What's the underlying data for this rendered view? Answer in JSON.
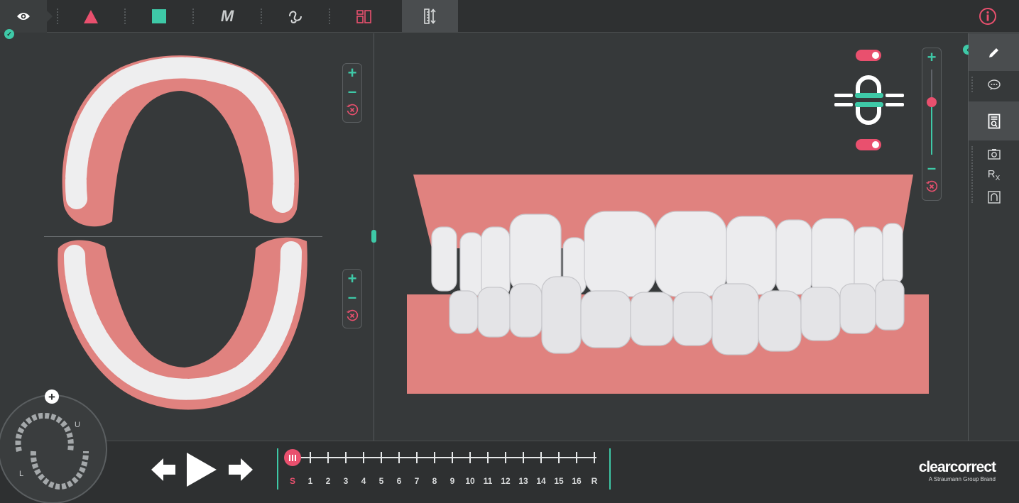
{
  "toolbar": {
    "tools": [
      {
        "name": "view",
        "icon": "eye-icon"
      },
      {
        "name": "shape",
        "icon": "triangle-icon",
        "color": "#e9506e"
      },
      {
        "name": "block",
        "icon": "square-icon",
        "color": "#3ec9a7"
      },
      {
        "name": "mode",
        "icon": "m-icon",
        "label": "M"
      },
      {
        "name": "wave",
        "icon": "wave-icon"
      },
      {
        "name": "layout",
        "icon": "split-view-icon",
        "color": "#e9506e"
      },
      {
        "name": "measure",
        "icon": "ruler-arrows-icon"
      }
    ],
    "info_icon": "info-icon",
    "info_color": "#e9506e"
  },
  "brand": {
    "name": "clearcorrect",
    "tagline": "A Straumann Group Brand"
  },
  "timeline": {
    "stages": [
      "S",
      "1",
      "2",
      "3",
      "4",
      "5",
      "6",
      "7",
      "8",
      "9",
      "10",
      "11",
      "12",
      "13",
      "14",
      "15",
      "16",
      "R"
    ],
    "current": "S",
    "active_color": "#e9506e"
  },
  "navigator": {
    "upper_label": "U",
    "lower_label": "L"
  },
  "colors": {
    "accent": "#3ec9a7",
    "alert": "#e9506e",
    "gum": "#e0827f",
    "tooth": "#e8e8ea",
    "background": "#36393a",
    "toolbar": "#2e3031"
  },
  "side_panel": {
    "items": [
      {
        "name": "edit",
        "icon": "pencil-icon"
      },
      {
        "name": "comments",
        "icon": "chat-icon"
      },
      {
        "name": "document",
        "icon": "document-search-icon"
      },
      {
        "name": "camera",
        "icon": "camera-icon"
      },
      {
        "name": "prescription",
        "icon": "rx-icon",
        "label": "R",
        "sub": "X"
      },
      {
        "name": "arch",
        "icon": "arch-icon"
      }
    ]
  },
  "view_controls": {
    "upper_toggle": "on",
    "lower_toggle": "on",
    "slider_level": 0.62
  }
}
